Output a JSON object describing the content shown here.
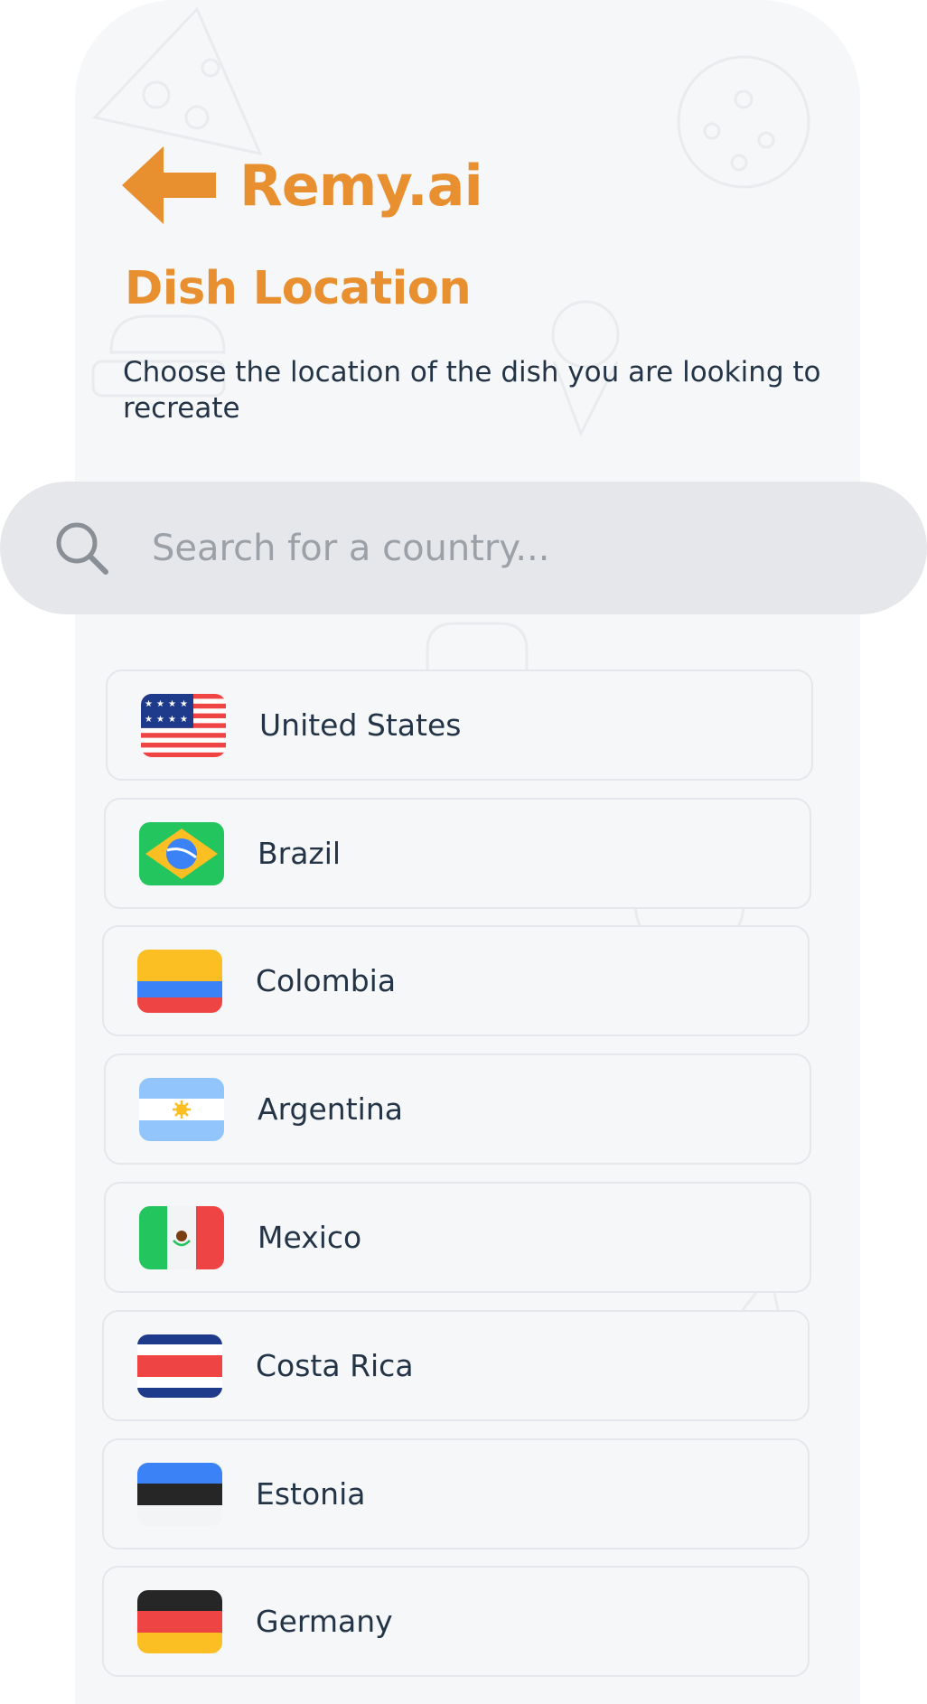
{
  "app": {
    "brand": "Remy.ai"
  },
  "page": {
    "title": "Dish Location",
    "subtitle": "Choose the location of the dish you are looking to recreate"
  },
  "search": {
    "placeholder": "Search for a country...",
    "value": ""
  },
  "countries": [
    {
      "name": "United States",
      "flag": "us-flag"
    },
    {
      "name": "Brazil",
      "flag": "brazil-flag"
    },
    {
      "name": "Colombia",
      "flag": "colombia-flag"
    },
    {
      "name": "Argentina",
      "flag": "argentina-flag"
    },
    {
      "name": "Mexico",
      "flag": "mexico-flag"
    },
    {
      "name": "Costa Rica",
      "flag": "costa-rica-flag"
    },
    {
      "name": "Estonia",
      "flag": "estonia-flag"
    },
    {
      "name": "Germany",
      "flag": "germany-flag"
    }
  ],
  "icons": {
    "back": "arrow-left-icon",
    "search": "search-icon"
  },
  "colors": {
    "accent": "#e88f30",
    "text": "#243447",
    "background": "#f6f7f9",
    "search_bg": "#e5e7ea"
  }
}
